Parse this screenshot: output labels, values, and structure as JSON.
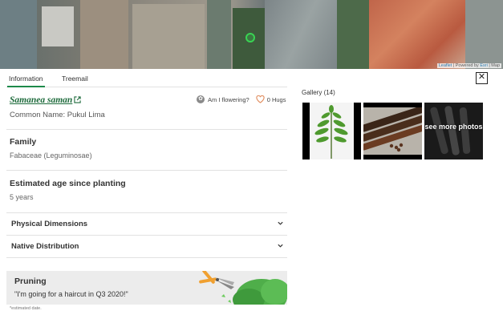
{
  "map": {
    "attribution_prefix": "",
    "attribution_leaflet": "Leaflet",
    "attribution_sep": "| Powered by",
    "attribution_esri": "Esri",
    "attribution_suffix": "| Map"
  },
  "tabs": [
    {
      "label": "Information",
      "active": true
    },
    {
      "label": "Treemail",
      "active": false
    }
  ],
  "close": {
    "label": "✕"
  },
  "tree": {
    "species": "Samanea saman",
    "common_name": "Common Name: Pukul Lima",
    "flowering_label": "Am I flowering?",
    "hugs": "0 Hugs"
  },
  "sections": {
    "family_title": "Family",
    "family_value": "Fabaceae (Leguminosae)",
    "age_title": "Estimated age since planting",
    "age_value": "5 years",
    "physical_label": "Physical Dimensions",
    "native_label": "Native Distribution"
  },
  "pruning": {
    "title": "Pruning",
    "quote": "\"I'm going for a haircut in Q3 2020!\"",
    "note": "*estimated date."
  },
  "gallery": {
    "title": "Gallery (14)",
    "see_more": "see more photos"
  },
  "colors": {
    "accent": "#1d8a4a",
    "species_link": "#1e6b3c",
    "heart": "#e08a5a",
    "pruning_bg": "#ececec"
  }
}
